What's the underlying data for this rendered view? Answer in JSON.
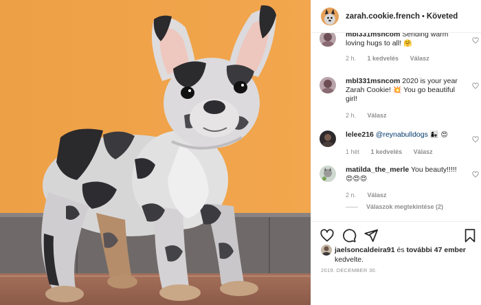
{
  "header": {
    "username": "zarah.cookie.french",
    "separator": "•",
    "follow_status": "Követed"
  },
  "comments": [
    {
      "username": "mbl331msncom",
      "text": "Sending warm loving hugs to all!",
      "emojis": "🤗",
      "time": "2 h.",
      "likes": "1 kedvelés",
      "reply": "Válasz"
    },
    {
      "username": "mbl331msncom",
      "text_before": "2020 is your year Zarah Cookie!",
      "emoji_mid": "💥",
      "text_after": "You go beautiful girl!",
      "time": "2 h.",
      "reply": "Válasz"
    },
    {
      "username": "lelee216",
      "mention": "@reynabulldogs",
      "emojis": "👩‍👧 😍",
      "time": "1 hét",
      "likes": "1 kedvelés",
      "reply": "Válasz"
    },
    {
      "username": "matilda_the_merle",
      "text": "You beauty!!!!!",
      "emojis": "😍😍😍",
      "time": "2 n.",
      "reply": "Válasz",
      "view_replies": "Válaszok megtekintése (2)"
    }
  ],
  "actions": {
    "like": "heart-icon",
    "comment": "comment-icon",
    "share": "share-icon",
    "save": "bookmark-icon"
  },
  "likes": {
    "username": "jaelsoncaldeira91",
    "connector": "és",
    "others": "további 47 ember",
    "suffix": "kedvelte."
  },
  "date": "2019. DECEMBER 30.",
  "colors": {
    "wall": "#f0a347",
    "text": "#262626",
    "secondary": "#8e8e8e",
    "mention": "#00376b"
  }
}
